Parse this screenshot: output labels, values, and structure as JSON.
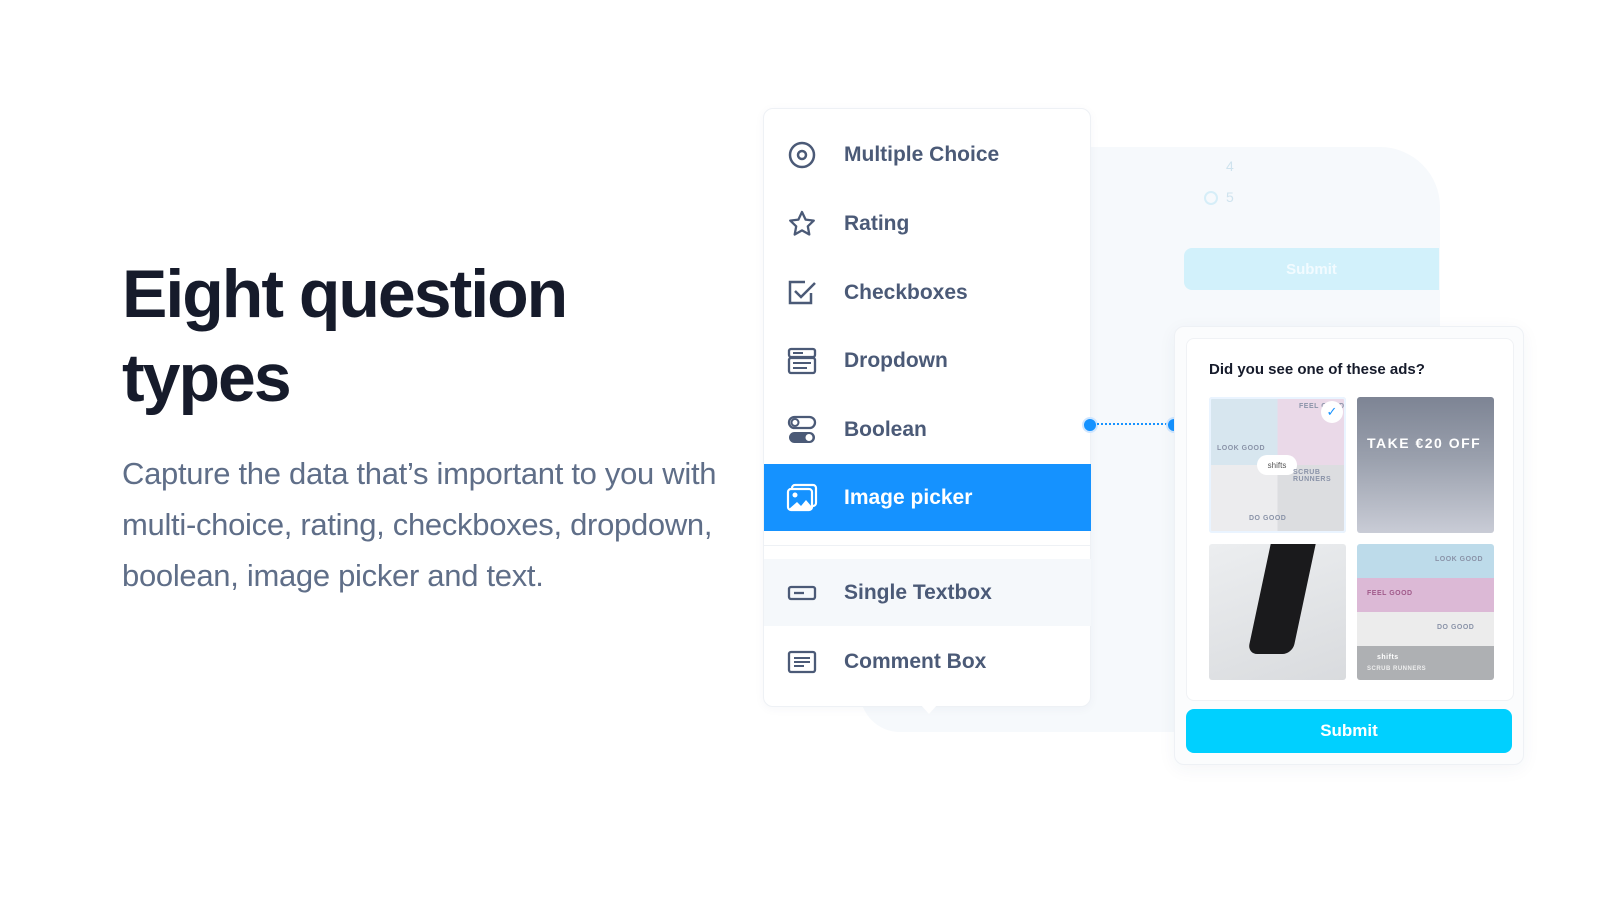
{
  "heading": {
    "title": "Eight question types",
    "description": "Capture the data that’s important to you with multi-choice, rating, checkboxes, dropdown, boolean, image picker and text."
  },
  "menu": {
    "items": [
      {
        "label": "Multiple Choice",
        "icon": "radio-icon"
      },
      {
        "label": "Rating",
        "icon": "star-icon"
      },
      {
        "label": "Checkboxes",
        "icon": "checkbox-icon"
      },
      {
        "label": "Dropdown",
        "icon": "dropdown-icon"
      },
      {
        "label": "Boolean",
        "icon": "toggle-icon"
      },
      {
        "label": "Image picker",
        "icon": "image-icon",
        "selected": true
      },
      {
        "label": "Single Textbox",
        "icon": "textbox-icon"
      },
      {
        "label": "Comment Box",
        "icon": "comment-box-icon"
      }
    ]
  },
  "background_form": {
    "option_4": "4",
    "option_5": "5",
    "submit_label": "Submit"
  },
  "preview": {
    "question": "Did you see one of these ads?",
    "ads": [
      {
        "texts": [
          "FEEL GOOD",
          "LOOK GOOD",
          "shifts",
          "SCRUB RUNNERS",
          "DO GOOD"
        ],
        "selected": true
      },
      {
        "texts": [
          "TAKE €20 OFF"
        ]
      },
      {
        "texts": []
      },
      {
        "texts": [
          "LOOK GOOD",
          "FEEL GOOD",
          "DO GOOD",
          "shifts",
          "SCRUB RUNNERS"
        ]
      }
    ],
    "submit_label": "Submit"
  },
  "colors": {
    "accent": "#1592ff",
    "submit": "#00d0ff",
    "heading": "#161b2b",
    "text": "#5f6e88"
  }
}
